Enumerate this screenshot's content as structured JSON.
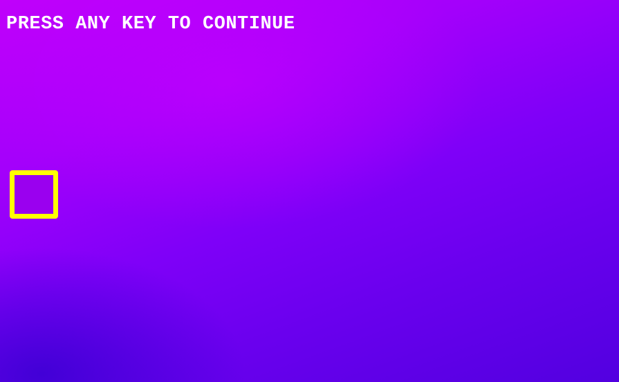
{
  "screen": {
    "prompt_text": "PRESS ANY KEY TO CONTINUE",
    "colors": {
      "background_top": "#c000fb",
      "background_bottom": "#5200e0",
      "text": "#ffffff",
      "box_border": "#ffff00",
      "box_fill": "#9a00ef"
    }
  }
}
